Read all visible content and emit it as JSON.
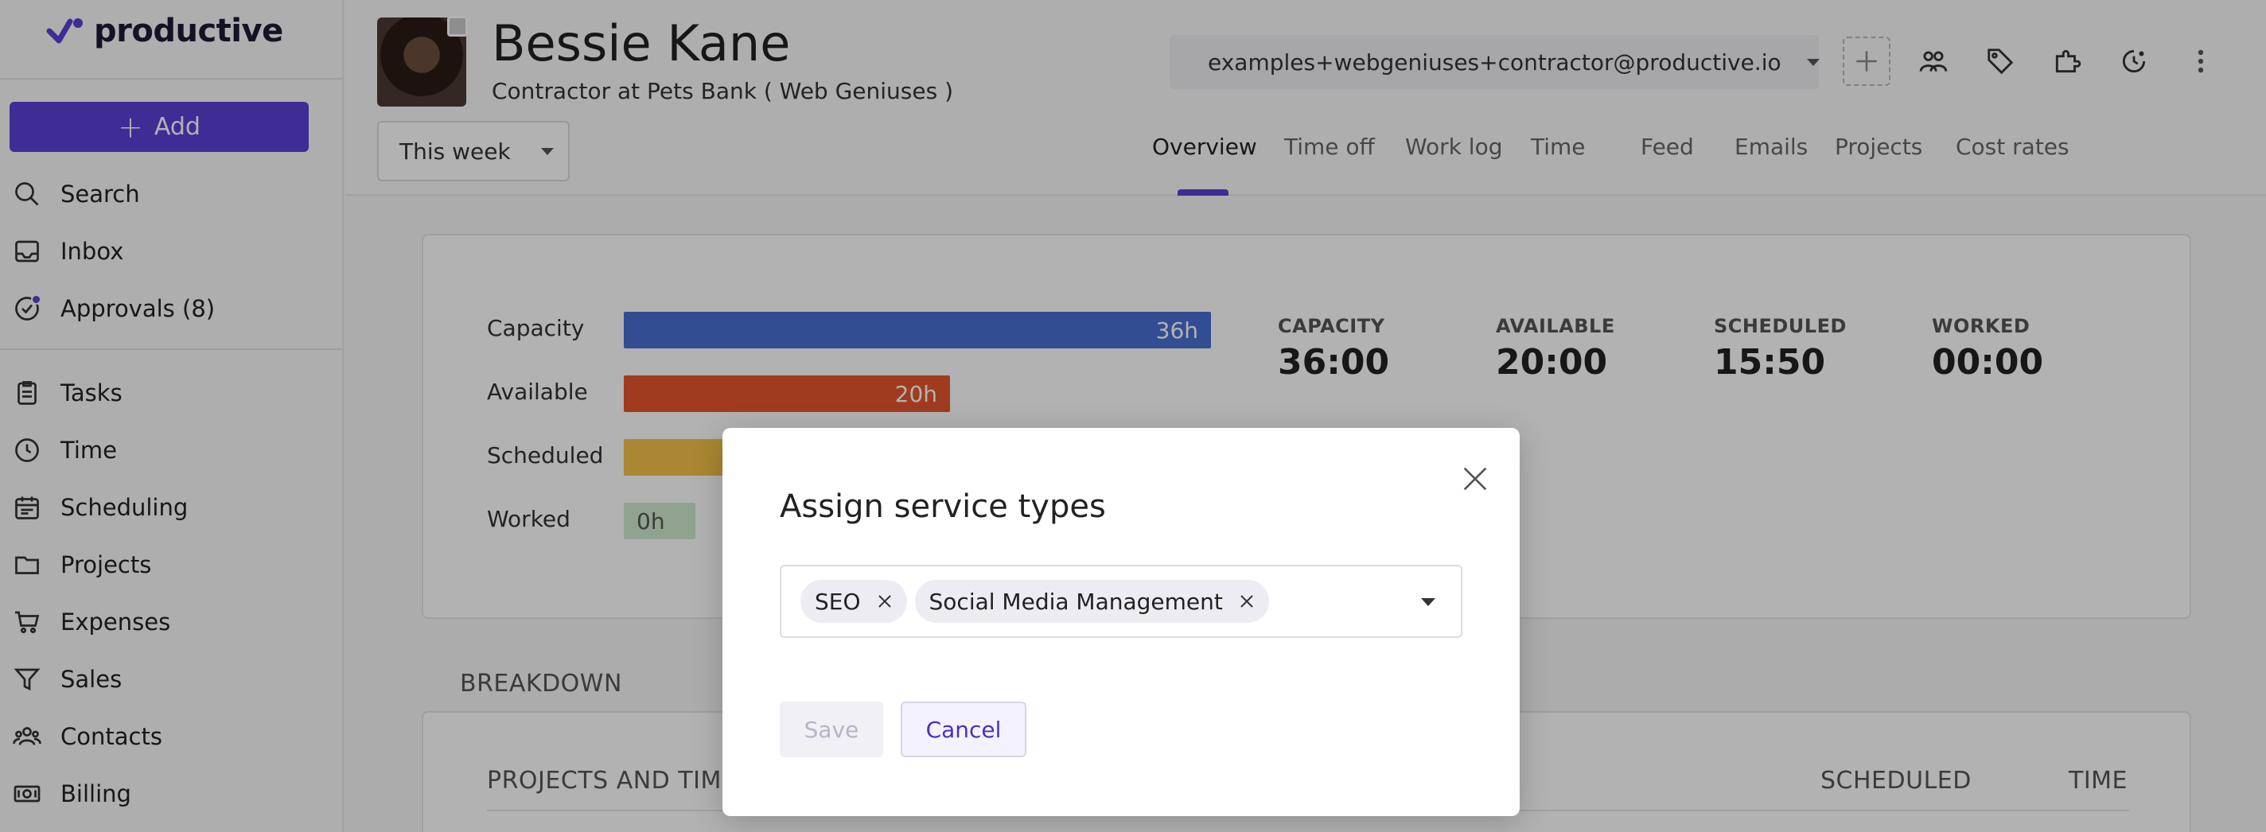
{
  "brand": {
    "name": "productive",
    "accent": "#5b3fd6"
  },
  "sidebar": {
    "add_label": "Add",
    "items": [
      {
        "label": "Search",
        "icon": "search-icon"
      },
      {
        "label": "Inbox",
        "icon": "inbox-icon"
      },
      {
        "label": "Approvals (8)",
        "icon": "approvals-icon"
      },
      {
        "label": "Tasks",
        "icon": "tasks-icon"
      },
      {
        "label": "Time",
        "icon": "clock-icon"
      },
      {
        "label": "Scheduling",
        "icon": "calendar-icon"
      },
      {
        "label": "Projects",
        "icon": "folder-icon"
      },
      {
        "label": "Expenses",
        "icon": "cart-icon"
      },
      {
        "label": "Sales",
        "icon": "funnel-icon"
      },
      {
        "label": "Contacts",
        "icon": "contacts-icon"
      },
      {
        "label": "Billing",
        "icon": "billing-icon"
      }
    ]
  },
  "header": {
    "name": "Bessie Kane",
    "role": "Contractor at Pets Bank ( Web Geniuses )",
    "period": "This week",
    "email": "examples+webgeniuses+contractor@productive.io",
    "tabs": [
      "Overview",
      "Time off",
      "Work log",
      "Time",
      "Feed",
      "Emails",
      "Projects",
      "Cost rates"
    ],
    "active_tab": "Overview"
  },
  "summary": {
    "bars": [
      {
        "label": "Capacity",
        "value_label": "36h",
        "fraction": 1.0,
        "color": "#4a6fd1"
      },
      {
        "label": "Available",
        "value_label": "20h",
        "fraction": 0.5556,
        "color": "#e5552e"
      },
      {
        "label": "Scheduled",
        "value_label": "",
        "fraction": 0.44,
        "color": "#f3c24a"
      },
      {
        "label": "Worked",
        "value_label": "0h",
        "fraction": 0.0,
        "color": "#cfe8cf"
      }
    ],
    "stats": [
      {
        "key": "CAPACITY",
        "value": "36:00"
      },
      {
        "key": "AVAILABLE",
        "value": "20:00"
      },
      {
        "key": "SCHEDULED",
        "value": "15:50"
      },
      {
        "key": "WORKED",
        "value": "00:00"
      }
    ]
  },
  "breakdown": {
    "title": "BREAKDOWN",
    "col_projects": "PROJECTS AND TIME",
    "col_scheduled": "SCHEDULED",
    "col_time": "TIME"
  },
  "modal": {
    "title": "Assign service types",
    "chips": [
      "SEO",
      "Social Media Management"
    ],
    "save_label": "Save",
    "cancel_label": "Cancel"
  }
}
